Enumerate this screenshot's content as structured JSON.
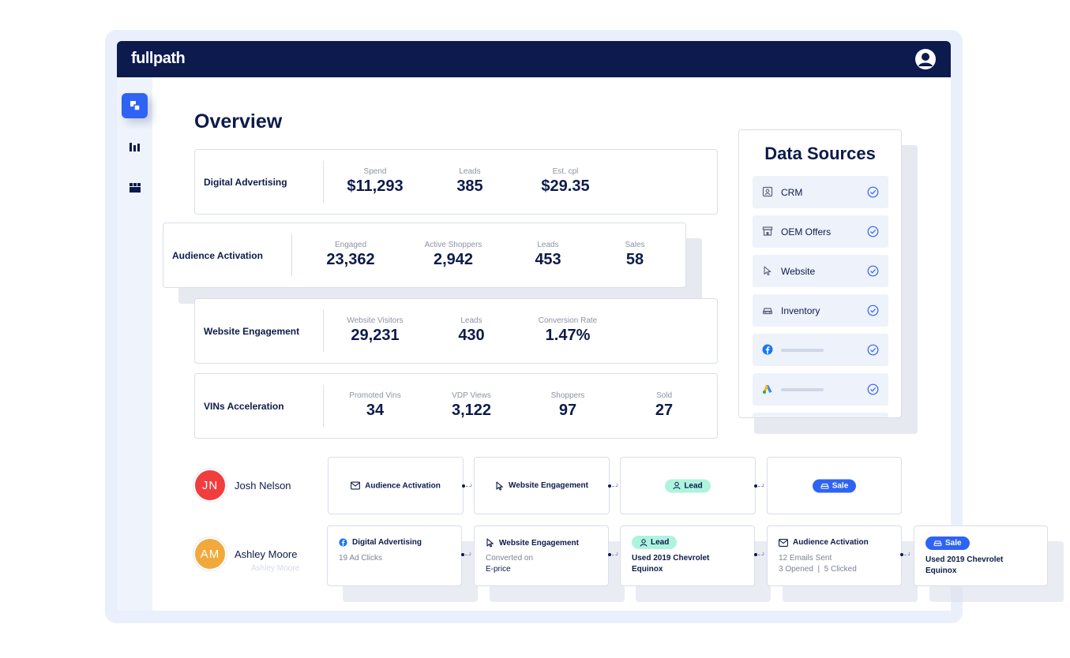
{
  "app": {
    "logo": "fullpath"
  },
  "page": {
    "title": "Overview"
  },
  "sidebar": {
    "items": [
      {
        "icon": "dashboard-icon",
        "active": true
      },
      {
        "icon": "bar-chart-icon",
        "active": false
      },
      {
        "icon": "store-icon",
        "active": false
      }
    ]
  },
  "cards": [
    {
      "label": "Digital Advertising",
      "metrics": [
        {
          "label": "Spend",
          "value": "$11,293"
        },
        {
          "label": "Leads",
          "value": "385"
        },
        {
          "label": "Est. cpl",
          "value": "$29.35"
        }
      ]
    },
    {
      "label": "Audience Activation",
      "metrics": [
        {
          "label": "Engaged",
          "value": "23,362"
        },
        {
          "label": "Active Shoppers",
          "value": "2,942"
        },
        {
          "label": "Leads",
          "value": "453"
        },
        {
          "label": "Sales",
          "value": "58"
        }
      ]
    },
    {
      "label": "Website Engagement",
      "metrics": [
        {
          "label": "Website Visitors",
          "value": "29,231"
        },
        {
          "label": "Leads",
          "value": "430"
        },
        {
          "label": "Conversion Rate",
          "value": "1.47%"
        }
      ]
    },
    {
      "label": "VINs Acceleration",
      "metrics": [
        {
          "label": "Promoted Vins",
          "value": "34"
        },
        {
          "label": "VDP Views",
          "value": "3,122"
        },
        {
          "label": "Shoppers",
          "value": "97"
        },
        {
          "label": "Sold",
          "value": "27"
        }
      ]
    }
  ],
  "data_sources": {
    "title": "Data Sources",
    "items": [
      {
        "name": "CRM",
        "icon": "contact-card-icon",
        "checked": true
      },
      {
        "name": "OEM Offers",
        "icon": "storefront-icon",
        "checked": true
      },
      {
        "name": "Website",
        "icon": "cursor-icon",
        "checked": true
      },
      {
        "name": "Inventory",
        "icon": "car-icon",
        "checked": true
      },
      {
        "name": "",
        "icon": "facebook-icon",
        "checked": true
      },
      {
        "name": "",
        "icon": "google-ads-icon",
        "checked": true
      }
    ]
  },
  "journeys": [
    {
      "initials": "JN",
      "name": "Josh Nelson",
      "color": "#f03e3e",
      "steps": [
        {
          "title": "Audience Activation",
          "icon": "mail-icon"
        },
        {
          "title": "Website Engagement",
          "icon": "cursor-icon"
        },
        {
          "pill": "Lead",
          "icon": "user-icon"
        },
        {
          "pill": "Sale",
          "icon": "car-icon"
        }
      ]
    },
    {
      "initials": "AM",
      "name": "Ashley Moore",
      "color": "#f2a93b",
      "ghost": "Ashley Moore",
      "steps": [
        {
          "title": "Digital Advertising",
          "icon": "facebook-icon",
          "detail": "19 Ad Clicks"
        },
        {
          "title": "Website Engagement",
          "icon": "cursor-icon",
          "detail_lines": [
            "Converted on",
            "E-price"
          ]
        },
        {
          "pill": "Lead",
          "icon": "user-icon",
          "detail_lines": [
            "Used 2019 Chevrolet",
            "Equinox"
          ]
        },
        {
          "title": "Audience Activation",
          "icon": "mail-icon",
          "detail_lines": [
            "12 Emails Sent",
            "3 Opened  |  5 Clicked"
          ]
        },
        {
          "pill": "Sale",
          "icon": "car-icon",
          "detail_lines": [
            "Used 2019 Chevrolet",
            "Equinox"
          ]
        }
      ]
    }
  ],
  "colors": {
    "navy": "#0c1a4e",
    "accent": "#2f63f4",
    "lead": "#aef3de"
  }
}
